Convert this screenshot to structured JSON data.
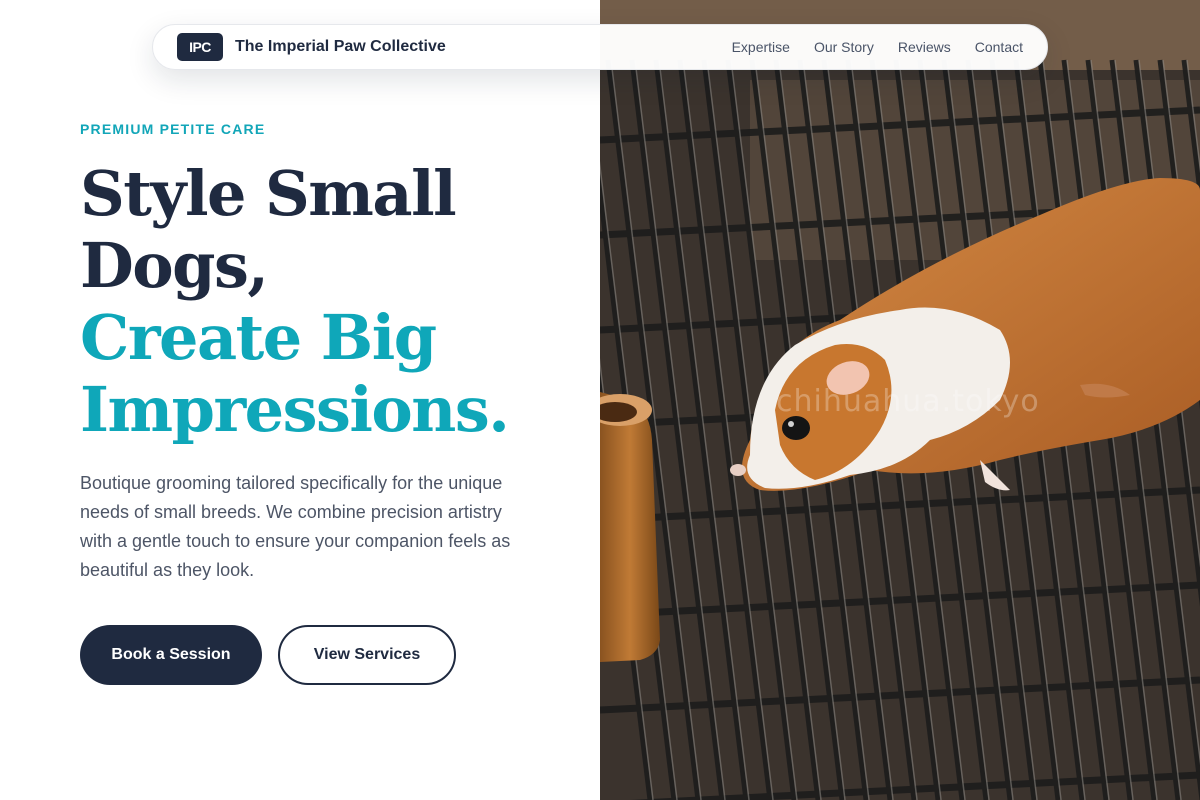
{
  "nav": {
    "logo_text": "IPC",
    "brand_name": "The Imperial Paw Collective",
    "links": [
      "Expertise",
      "Our Story",
      "Reviews",
      "Contact"
    ]
  },
  "hero": {
    "eyebrow": "PREMIUM PETITE CARE",
    "headline_line1": "Style Small",
    "headline_line2": "Dogs,",
    "headline_line3": "Create Big",
    "headline_line4": "Impressions.",
    "description": "Boutique grooming tailored specifically for the unique needs of small breeds. We combine precision artistry with a gentle touch to ensure your companion feels as beautiful as they look.",
    "primary_button": "Book a Session",
    "secondary_button": "View Services",
    "image_watermark": "chihuahua.tokyo"
  },
  "colors": {
    "brand_dark": "#1f2a40",
    "accent_teal": "#0fa7b9",
    "body_text": "#4d5566"
  },
  "icons": {
    "hero_image": "guinea-pig-on-grate-photo"
  }
}
